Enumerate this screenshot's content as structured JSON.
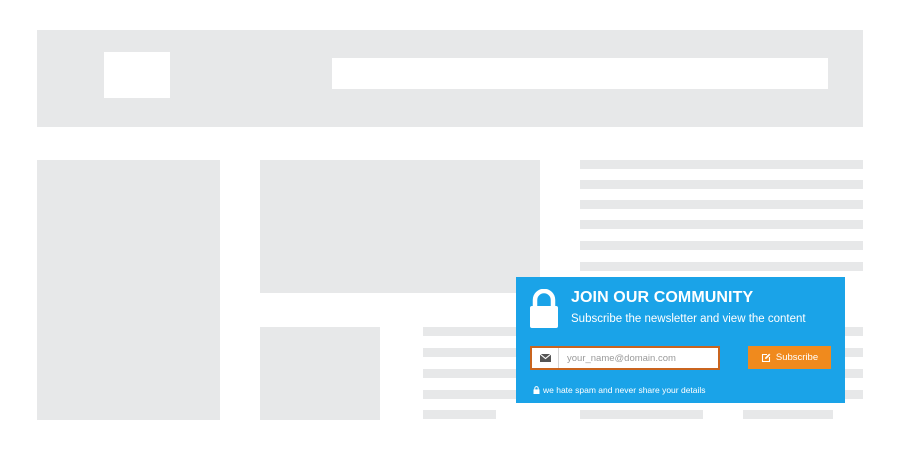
{
  "newsletter": {
    "title": "JOIN OUR COMMUNITY",
    "subtitle": "Subscribe the newsletter and view the content",
    "email_placeholder": "your_name@domain.com",
    "email_value": "",
    "subscribe_label": "Subscribe",
    "spam_note": "we hate spam and never share your details",
    "icons": {
      "header": "lock-icon",
      "email": "envelope-icon",
      "button": "edit-icon",
      "note": "small-lock-icon"
    },
    "colors": {
      "panel": "#1aa3e8",
      "button": "#f08a1d",
      "field_border": "#c9641f"
    }
  },
  "wireframe": {
    "placeholder_color": "#e7e8e9"
  }
}
